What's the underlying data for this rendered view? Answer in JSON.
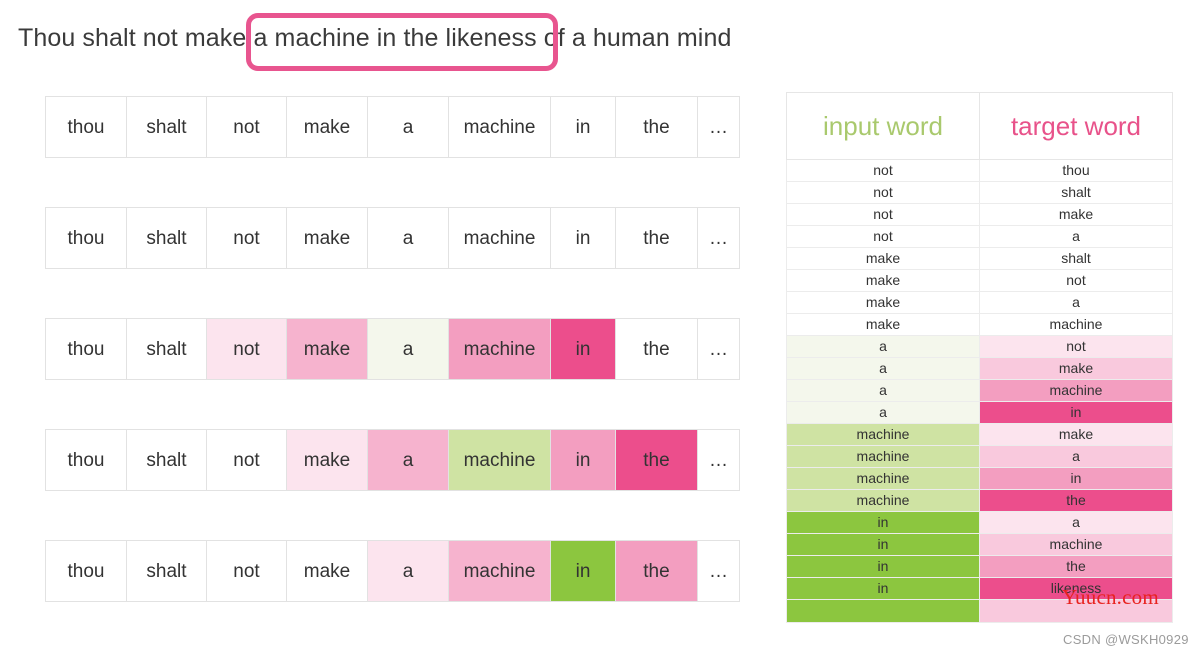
{
  "sentence": {
    "before": "Thou shalt not make",
    "highlighted": " a machine in the likeness ",
    "after": "of a human mind",
    "highlight_color": "#e8558f"
  },
  "palette": {
    "white": "#ffffff",
    "pink_1": "#fce4ee",
    "pink_2": "#f9c9dd",
    "pink_3": "#f39ec0",
    "pink_4": "#ec4e8c",
    "pink_5": "#f6b3ce",
    "green_1": "#f4f7ec",
    "green_2": "#cfe3a3",
    "green_3": "#8cc63f",
    "header_green": "#a9c96d",
    "header_pink": "#e8528a"
  },
  "word_grid": {
    "columns": [
      "thou",
      "shalt",
      "not",
      "make",
      "a",
      "machine",
      "in",
      "the",
      "…"
    ],
    "rows": [
      {
        "cells": [
          {
            "text": "thou",
            "bg": "#ffffff"
          },
          {
            "text": "shalt",
            "bg": "#ffffff"
          },
          {
            "text": "not",
            "bg": "#ffffff"
          },
          {
            "text": "make",
            "bg": "#ffffff"
          },
          {
            "text": "a",
            "bg": "#ffffff"
          },
          {
            "text": "machine",
            "bg": "#ffffff"
          },
          {
            "text": "in",
            "bg": "#ffffff"
          },
          {
            "text": "the",
            "bg": "#ffffff"
          },
          {
            "text": "…",
            "bg": "#ffffff"
          }
        ]
      },
      {
        "cells": [
          {
            "text": "thou",
            "bg": "#ffffff"
          },
          {
            "text": "shalt",
            "bg": "#ffffff"
          },
          {
            "text": "not",
            "bg": "#ffffff"
          },
          {
            "text": "make",
            "bg": "#ffffff"
          },
          {
            "text": "a",
            "bg": "#ffffff"
          },
          {
            "text": "machine",
            "bg": "#ffffff"
          },
          {
            "text": "in",
            "bg": "#ffffff"
          },
          {
            "text": "the",
            "bg": "#ffffff"
          },
          {
            "text": "…",
            "bg": "#ffffff"
          }
        ]
      },
      {
        "cells": [
          {
            "text": "thou",
            "bg": "#ffffff"
          },
          {
            "text": "shalt",
            "bg": "#ffffff"
          },
          {
            "text": "not",
            "bg": "#fce4ee"
          },
          {
            "text": "make",
            "bg": "#f6b3ce"
          },
          {
            "text": "a",
            "bg": "#f4f7ec"
          },
          {
            "text": "machine",
            "bg": "#f39ec0"
          },
          {
            "text": "in",
            "bg": "#ec4e8c"
          },
          {
            "text": "the",
            "bg": "#ffffff"
          },
          {
            "text": "…",
            "bg": "#ffffff"
          }
        ]
      },
      {
        "cells": [
          {
            "text": "thou",
            "bg": "#ffffff"
          },
          {
            "text": "shalt",
            "bg": "#ffffff"
          },
          {
            "text": "not",
            "bg": "#ffffff"
          },
          {
            "text": "make",
            "bg": "#fce4ee"
          },
          {
            "text": "a",
            "bg": "#f6b3ce"
          },
          {
            "text": "machine",
            "bg": "#cfe3a3"
          },
          {
            "text": "in",
            "bg": "#f39ec0"
          },
          {
            "text": "the",
            "bg": "#ec4e8c"
          },
          {
            "text": "…",
            "bg": "#ffffff"
          }
        ]
      },
      {
        "cells": [
          {
            "text": "thou",
            "bg": "#ffffff"
          },
          {
            "text": "shalt",
            "bg": "#ffffff"
          },
          {
            "text": "not",
            "bg": "#ffffff"
          },
          {
            "text": "make",
            "bg": "#ffffff"
          },
          {
            "text": "a",
            "bg": "#fce4ee"
          },
          {
            "text": "machine",
            "bg": "#f6b3ce"
          },
          {
            "text": "in",
            "bg": "#8cc63f"
          },
          {
            "text": "the",
            "bg": "#f39ec0"
          },
          {
            "text": "…",
            "bg": "#ffffff"
          }
        ]
      }
    ]
  },
  "pair_table": {
    "headers": {
      "input": "input word",
      "target": "target word"
    },
    "rows": [
      {
        "input": "not",
        "target": "thou",
        "input_bg": "#ffffff",
        "target_bg": "#ffffff"
      },
      {
        "input": "not",
        "target": "shalt",
        "input_bg": "#ffffff",
        "target_bg": "#ffffff"
      },
      {
        "input": "not",
        "target": "make",
        "input_bg": "#ffffff",
        "target_bg": "#ffffff"
      },
      {
        "input": "not",
        "target": "a",
        "input_bg": "#ffffff",
        "target_bg": "#ffffff"
      },
      {
        "input": "make",
        "target": "shalt",
        "input_bg": "#ffffff",
        "target_bg": "#ffffff"
      },
      {
        "input": "make",
        "target": "not",
        "input_bg": "#ffffff",
        "target_bg": "#ffffff"
      },
      {
        "input": "make",
        "target": "a",
        "input_bg": "#ffffff",
        "target_bg": "#ffffff"
      },
      {
        "input": "make",
        "target": "machine",
        "input_bg": "#ffffff",
        "target_bg": "#ffffff"
      },
      {
        "input": "a",
        "target": "not",
        "input_bg": "#f4f7ec",
        "target_bg": "#fce4ee"
      },
      {
        "input": "a",
        "target": "make",
        "input_bg": "#f4f7ec",
        "target_bg": "#f9c9dd"
      },
      {
        "input": "a",
        "target": "machine",
        "input_bg": "#f4f7ec",
        "target_bg": "#f39ec0"
      },
      {
        "input": "a",
        "target": "in",
        "input_bg": "#f4f7ec",
        "target_bg": "#ec4e8c"
      },
      {
        "input": "machine",
        "target": "make",
        "input_bg": "#cfe3a3",
        "target_bg": "#fce4ee"
      },
      {
        "input": "machine",
        "target": "a",
        "input_bg": "#cfe3a3",
        "target_bg": "#f9c9dd"
      },
      {
        "input": "machine",
        "target": "in",
        "input_bg": "#cfe3a3",
        "target_bg": "#f39ec0"
      },
      {
        "input": "machine",
        "target": "the",
        "input_bg": "#cfe3a3",
        "target_bg": "#ec4e8c"
      },
      {
        "input": "in",
        "target": "a",
        "input_bg": "#8cc63f",
        "target_bg": "#fce4ee"
      },
      {
        "input": "in",
        "target": "machine",
        "input_bg": "#8cc63f",
        "target_bg": "#f9c9dd"
      },
      {
        "input": "in",
        "target": "the",
        "input_bg": "#8cc63f",
        "target_bg": "#f39ec0"
      },
      {
        "input": "in",
        "target": "likeness",
        "input_bg": "#8cc63f",
        "target_bg": "#ec4e8c"
      },
      {
        "input": "",
        "target": "",
        "input_bg": "#8cc63f",
        "target_bg": "#f9c9dd"
      }
    ]
  },
  "watermarks": {
    "yuucn": "Yuucn.com",
    "csdn": "CSDN @WSKH0929"
  }
}
